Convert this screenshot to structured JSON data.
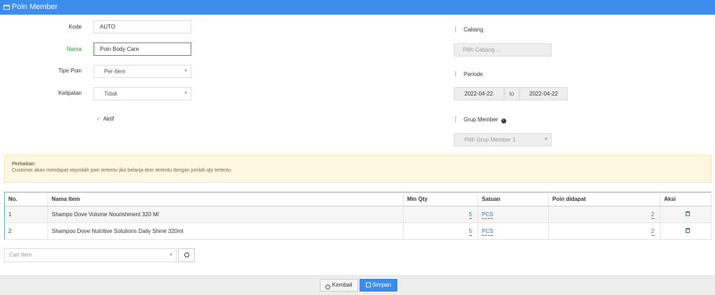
{
  "title": "Poin Member",
  "form": {
    "kode_label": "Kode",
    "kode_value": "AUTO",
    "nama_label": "Nama",
    "nama_value": "Poin Body Care",
    "tipe_label": "Tipe Poin",
    "tipe_value": "Per-Item",
    "kelipatan_label": "Kelipatan",
    "kelipatan_value": "Tidak",
    "aktif_label": "Aktif"
  },
  "right": {
    "cabang_label": "Cabang",
    "cabang_placeholder": "Pilih Cabang ...",
    "periode_label": "Periode",
    "periode_from": "2022-04-22",
    "periode_to_label": "to",
    "periode_to": "2022-04-22",
    "grup_label": "Grup Member",
    "grup_placeholder": "Pilih Grup Member 1"
  },
  "notice": {
    "title": "Perhatian:",
    "text": "Customer akan mendapat sejumlah poin tertentu jika belanja item tertentu dengan jumlah qty tertentu"
  },
  "table": {
    "headers": [
      "No.",
      "Nama Item",
      "Min Qty",
      "Satuan",
      "Poin didapat",
      "Aksi"
    ],
    "rows": [
      {
        "no": "1",
        "item": "Shampo Dove Volume Nourishment 320 Ml",
        "min_qty": "5",
        "satuan": "PCS",
        "poin": "2"
      },
      {
        "no": "2",
        "item": "Shampoo Dove Nutritive Solutions Daily Shine 320ml",
        "min_qty": "5",
        "satuan": "PCS",
        "poin": "2"
      }
    ]
  },
  "search": {
    "placeholder": "Cari Item"
  },
  "buttons": {
    "back": "Kembali",
    "save": "Simpan"
  },
  "colors": {
    "header": "#3c8dee",
    "notice_bg": "#fdf6e0"
  },
  "icons": {
    "title": "card-icon",
    "info": "info-icon",
    "delete": "trash-icon",
    "search": "search-icon"
  }
}
